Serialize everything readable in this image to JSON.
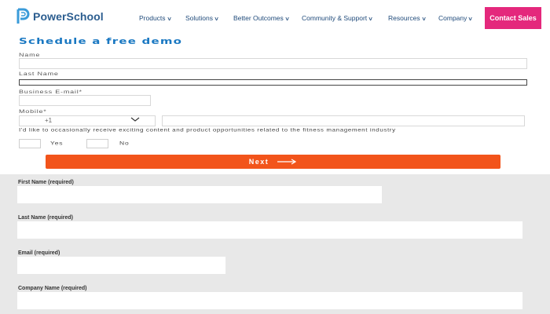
{
  "header": {
    "brand": "PowerSchool",
    "nav": [
      {
        "label": "Products"
      },
      {
        "label": "Solutions"
      },
      {
        "label": "Better Outcomes"
      },
      {
        "label": "Community & Support"
      },
      {
        "label": "Resources"
      },
      {
        "label": "Company"
      }
    ],
    "cta_label": "Contact Sales",
    "colors": {
      "brand": "#2b5d8f",
      "cta": "#e4287c"
    }
  },
  "demo_form": {
    "title": "Schedule a free demo",
    "name_label": "Name",
    "last_name_label": "Last Name",
    "business_email_label": "Business E-mail*",
    "mobile_label": "Mobile*",
    "country_code": "+1",
    "consent_text": "I'd like to occasionally receive exciting content and product opportunities related to the fitness management industry",
    "yes_label": "Yes",
    "no_label": "No",
    "next_label": "Next",
    "colors": {
      "title": "#1a78c2",
      "next": "#f2541b"
    }
  },
  "contact_form": {
    "first_name_label": "First Name (required)",
    "last_name_label": "Last Name (required)",
    "email_label": "Email (required)",
    "company_label": "Company Name (required)"
  }
}
